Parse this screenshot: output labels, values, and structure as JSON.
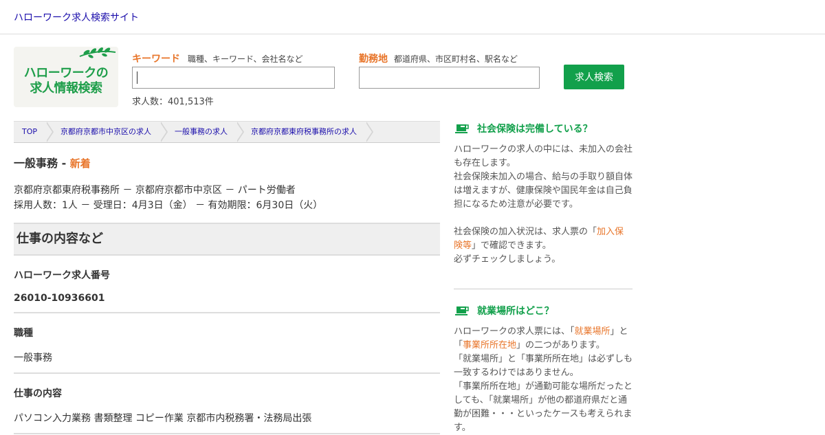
{
  "header": {
    "site_title": "ハローワーク求人検索サイト"
  },
  "logo": {
    "line1": "ハローワークの",
    "line2": "求人情報検索"
  },
  "search": {
    "keyword_label": "キーワード",
    "keyword_hint": "職種、キーワード、会社名など",
    "keyword_value": "",
    "location_label": "勤務地",
    "location_hint": "都道府県、市区町村名、駅名など",
    "location_value": "",
    "button_label": "求人検索",
    "count_text": "求人数：401,513件"
  },
  "breadcrumb": [
    {
      "label": "TOP"
    },
    {
      "label": "京都府京都市中京区の求人"
    },
    {
      "label": "一般事務の求人"
    },
    {
      "label": "京都府京都東府税事務所の求人"
    }
  ],
  "job": {
    "title": "一般事務",
    "title_separator": " - ",
    "new_badge": "新着",
    "meta_line1": "京都府京都東府税事務所 － 京都府京都市中京区 － パート労働者",
    "meta_line2": "採用人数：1人 － 受理日：4月3日（金） － 有効期限：6月30日（火）"
  },
  "section": {
    "title": "仕事の内容など"
  },
  "items": [
    {
      "label": "ハローワーク求人番号",
      "value": "26010-10936601"
    },
    {
      "label": "職種",
      "value": "一般事務"
    },
    {
      "label": "仕事の内容",
      "value": "パソコン入力業務 書類整理 コピー作業 京都市内税務署・法務局出張"
    }
  ],
  "sidebar": {
    "insurance": {
      "heading": "社会保険は完備している？",
      "text1": "ハローワークの求人の中には、未加入の会社も存在します。",
      "text2": "社会保険未加入の場合、給与の手取り額自体は増えますが、健康保険や国民年金は自己負担になるため注意が必要です。",
      "text3_pre": "社会保険の加入状況は、求人票の「",
      "text3_link": "加入保険等",
      "text3_post": "」で確認できます。",
      "text4": "必ずチェックしましょう。"
    },
    "workplace": {
      "heading": "就業場所はどこ？",
      "t1_pre": "ハローワークの求人票には、「",
      "t1_link1": "就業場所",
      "t1_mid": "」と「",
      "t1_link2": "事業所所在地",
      "t1_post": "」の二つがあります。",
      "t2": "「就業場所」と「事業所所在地」は必ずしも一致するわけではありません。",
      "t3": "「事業所所在地」が通勤可能な場所だったとしても、「就業場所」が他の都道府県だと通勤が困難・・・といったケースも考えられます。"
    }
  },
  "colors": {
    "accent_green": "#12a04b",
    "accent_orange": "#e8752a",
    "link_blue": "#1a0dab"
  }
}
